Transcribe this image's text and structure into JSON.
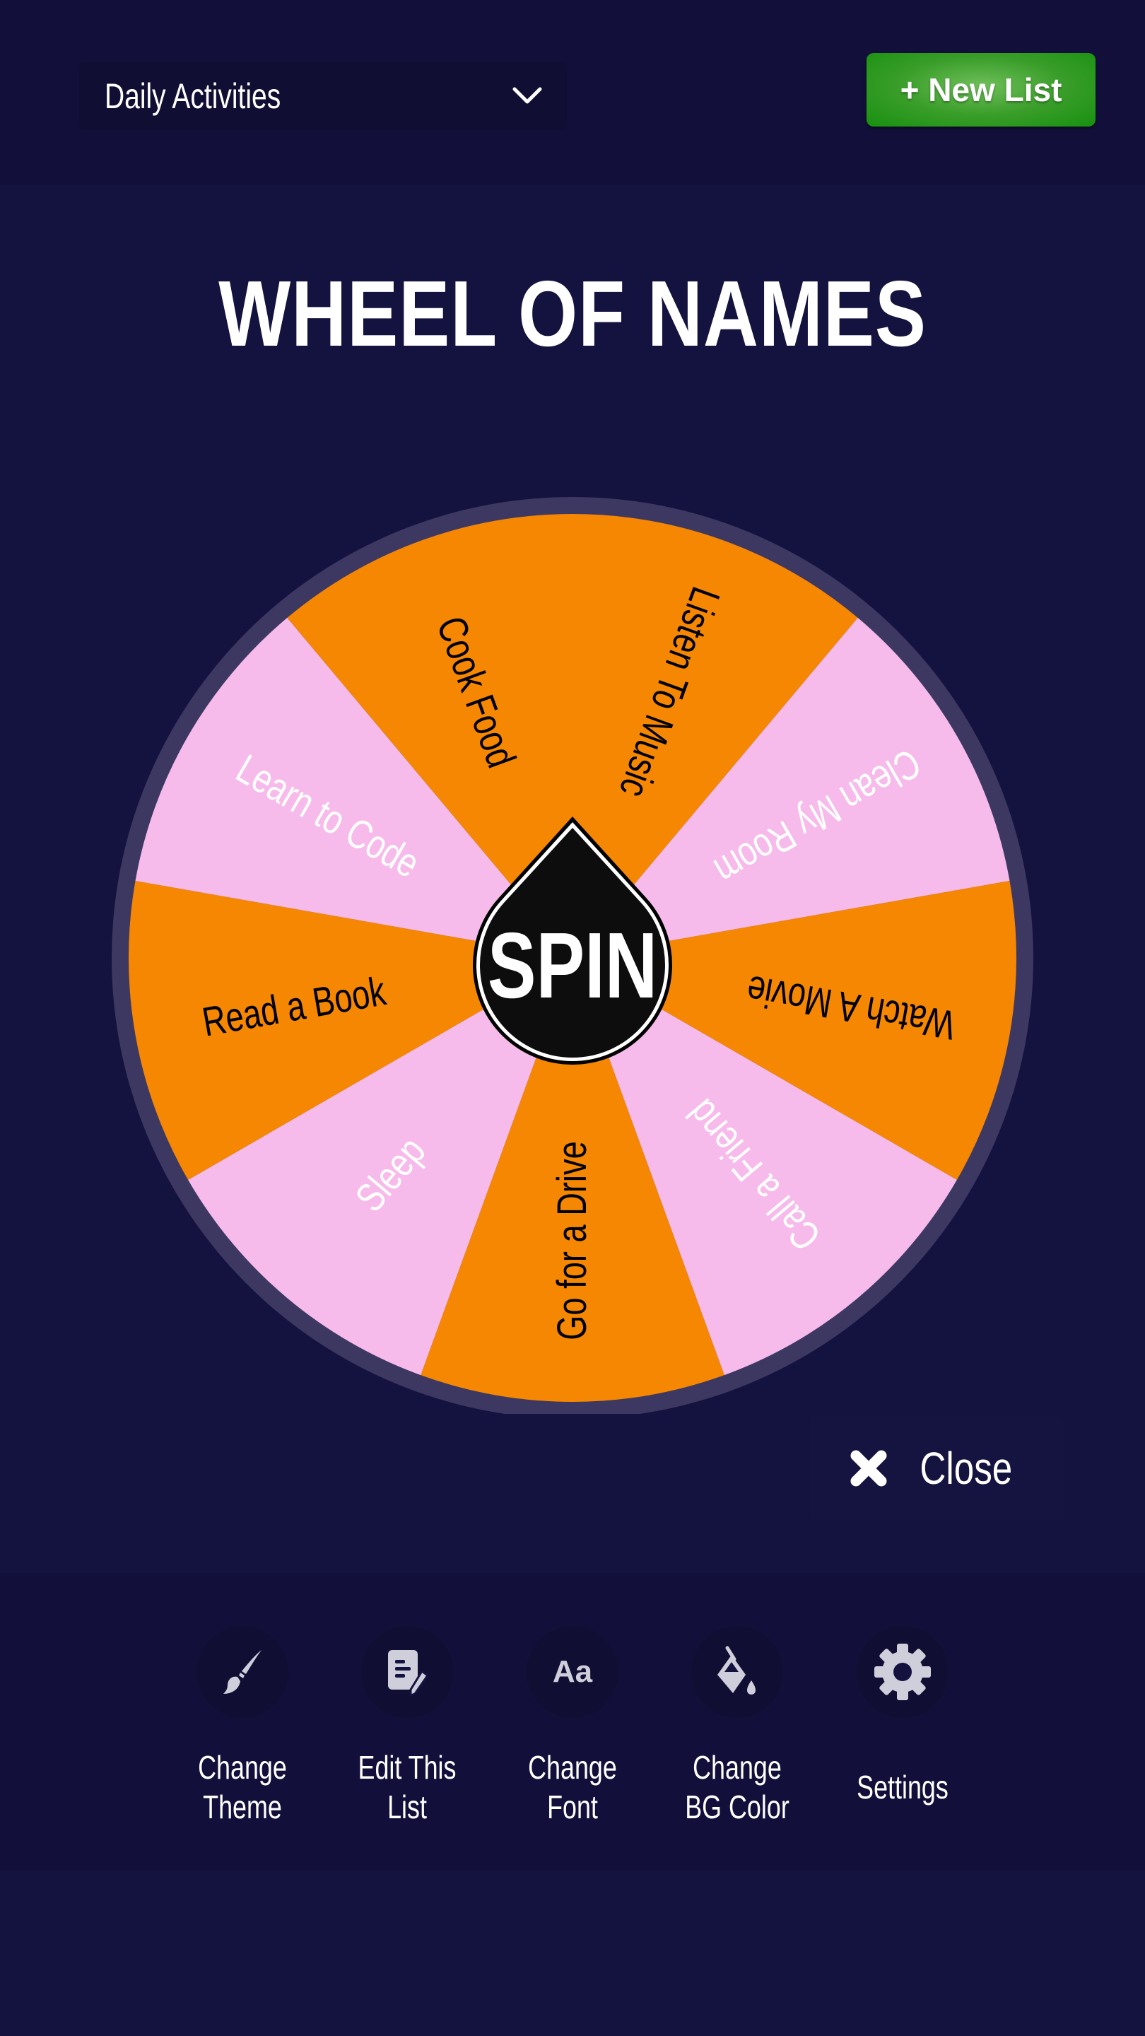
{
  "header": {
    "list_selector": {
      "value": "Daily Activities",
      "icon": "chevron-down-icon"
    },
    "new_list_button": "+ New List"
  },
  "title": "WHEEL OF NAMES",
  "wheel": {
    "spin_label": "SPIN",
    "colors": {
      "orange": "#f58703",
      "pink": "#f7bbeb",
      "rim": "#3d3862",
      "hub": "#0d0d0d"
    },
    "segments": [
      {
        "label": "Listen To Music",
        "color": "orange",
        "text_color": "#000000"
      },
      {
        "label": "Clean My Room",
        "color": "pink",
        "text_color": "#ffffff"
      },
      {
        "label": "Watch A Movie",
        "color": "orange",
        "text_color": "#000000"
      },
      {
        "label": "Call a Friend",
        "color": "pink",
        "text_color": "#ffffff"
      },
      {
        "label": "Go for a Drive",
        "color": "orange",
        "text_color": "#000000"
      },
      {
        "label": "Sleep",
        "color": "pink",
        "text_color": "#ffffff"
      },
      {
        "label": "Read a Book",
        "color": "orange",
        "text_color": "#000000"
      },
      {
        "label": "Learn to Code",
        "color": "pink",
        "text_color": "#ffffff"
      },
      {
        "label": "Cook Food",
        "color": "orange",
        "text_color": "#000000"
      }
    ]
  },
  "close_button": {
    "label": "Close",
    "icon": "close-icon"
  },
  "toolbar": {
    "items": [
      {
        "label": "Change\nTheme",
        "icon": "paintbrush-icon"
      },
      {
        "label": "Edit This\nList",
        "icon": "edit-list-icon"
      },
      {
        "label": "Change\nFont",
        "icon": "font-icon",
        "icon_text": "Aa"
      },
      {
        "label": "Change\nBG Color",
        "icon": "paint-bucket-icon"
      },
      {
        "label": "Settings",
        "icon": "gear-icon"
      }
    ]
  }
}
